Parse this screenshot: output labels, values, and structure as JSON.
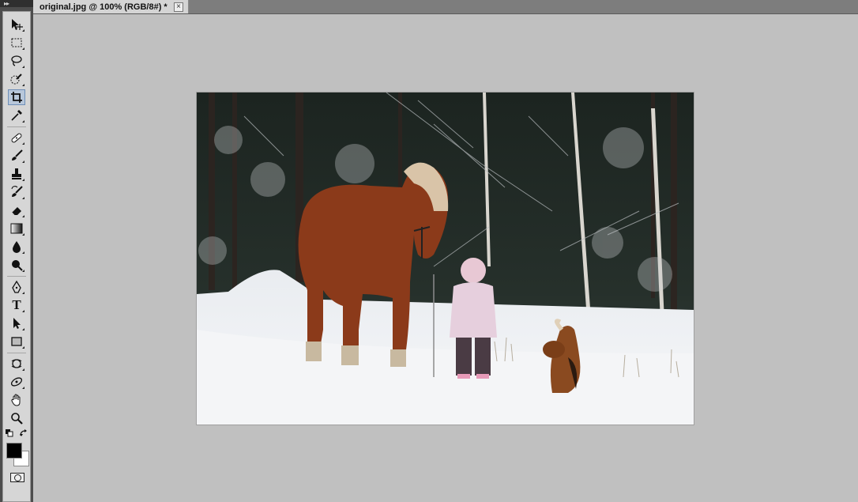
{
  "document": {
    "tab_title": "original.jpg @ 100% (RGB/8#) *",
    "close_glyph": "×"
  },
  "toolbox": {
    "tools": [
      {
        "name": "move-tool-icon"
      },
      {
        "name": "marquee-tool-icon"
      },
      {
        "name": "lasso-tool-icon"
      },
      {
        "name": "quick-selection-tool-icon"
      },
      {
        "name": "crop-tool-icon",
        "active": true
      },
      {
        "name": "eyedropper-tool-icon"
      },
      {
        "name": "healing-brush-tool-icon"
      },
      {
        "name": "brush-tool-icon"
      },
      {
        "name": "clone-stamp-tool-icon"
      },
      {
        "name": "history-brush-tool-icon"
      },
      {
        "name": "eraser-tool-icon"
      },
      {
        "name": "gradient-tool-icon"
      },
      {
        "name": "blur-tool-icon"
      },
      {
        "name": "dodge-tool-icon"
      },
      {
        "name": "pen-tool-icon"
      },
      {
        "name": "type-tool-icon"
      },
      {
        "name": "path-selection-tool-icon"
      },
      {
        "name": "rectangle-tool-icon"
      },
      {
        "name": "3d-rotate-tool-icon"
      },
      {
        "name": "3d-orbit-tool-icon"
      },
      {
        "name": "hand-tool-icon"
      },
      {
        "name": "zoom-tool-icon"
      }
    ],
    "type_tool_glyph": "T",
    "foreground_color": "#000000",
    "background_color": "#ffffff"
  }
}
